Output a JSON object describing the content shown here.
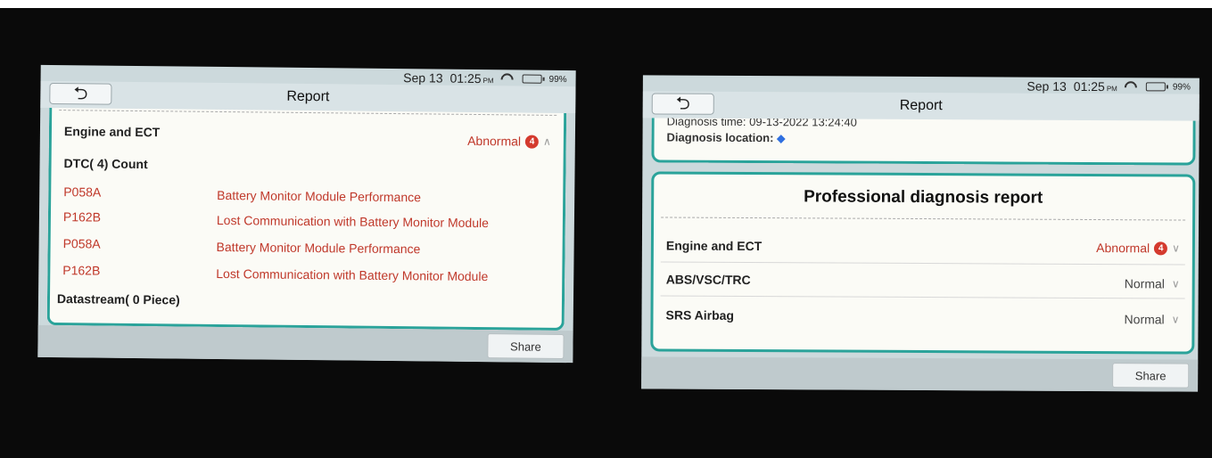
{
  "left": {
    "status": {
      "date": "Sep 13",
      "time": "01:25",
      "ampm": "PM",
      "battery": "99%"
    },
    "title": "Report",
    "system": "Engine and ECT",
    "status_label": "Abnormal",
    "badge": "4",
    "dtc_count": "DTC( 4) Count",
    "dtcs": [
      {
        "code": "P058A",
        "desc": "Battery Monitor Module Performance"
      },
      {
        "code": "P162B",
        "desc": "Lost Communication with Battery Monitor Module"
      },
      {
        "code": "P058A",
        "desc": "Battery Monitor Module Performance"
      },
      {
        "code": "P162B",
        "desc": "Lost Communication with Battery Monitor Module"
      }
    ],
    "datastream": "Datastream( 0 Piece)",
    "share": "Share"
  },
  "right": {
    "status": {
      "date": "Sep 13",
      "time": "01:25",
      "ampm": "PM",
      "battery": "99%"
    },
    "title": "Report",
    "diag_time": "Diagnosis time: 09-13-2022 13:24:40",
    "diag_location": "Diagnosis location:",
    "report_title": "Professional diagnosis report",
    "systems": [
      {
        "name": "Engine and ECT",
        "status": "Abnormal",
        "badge": "4"
      },
      {
        "name": "ABS/VSC/TRC",
        "status": "Normal"
      },
      {
        "name": "SRS Airbag",
        "status": "Normal"
      }
    ],
    "share": "Share"
  }
}
